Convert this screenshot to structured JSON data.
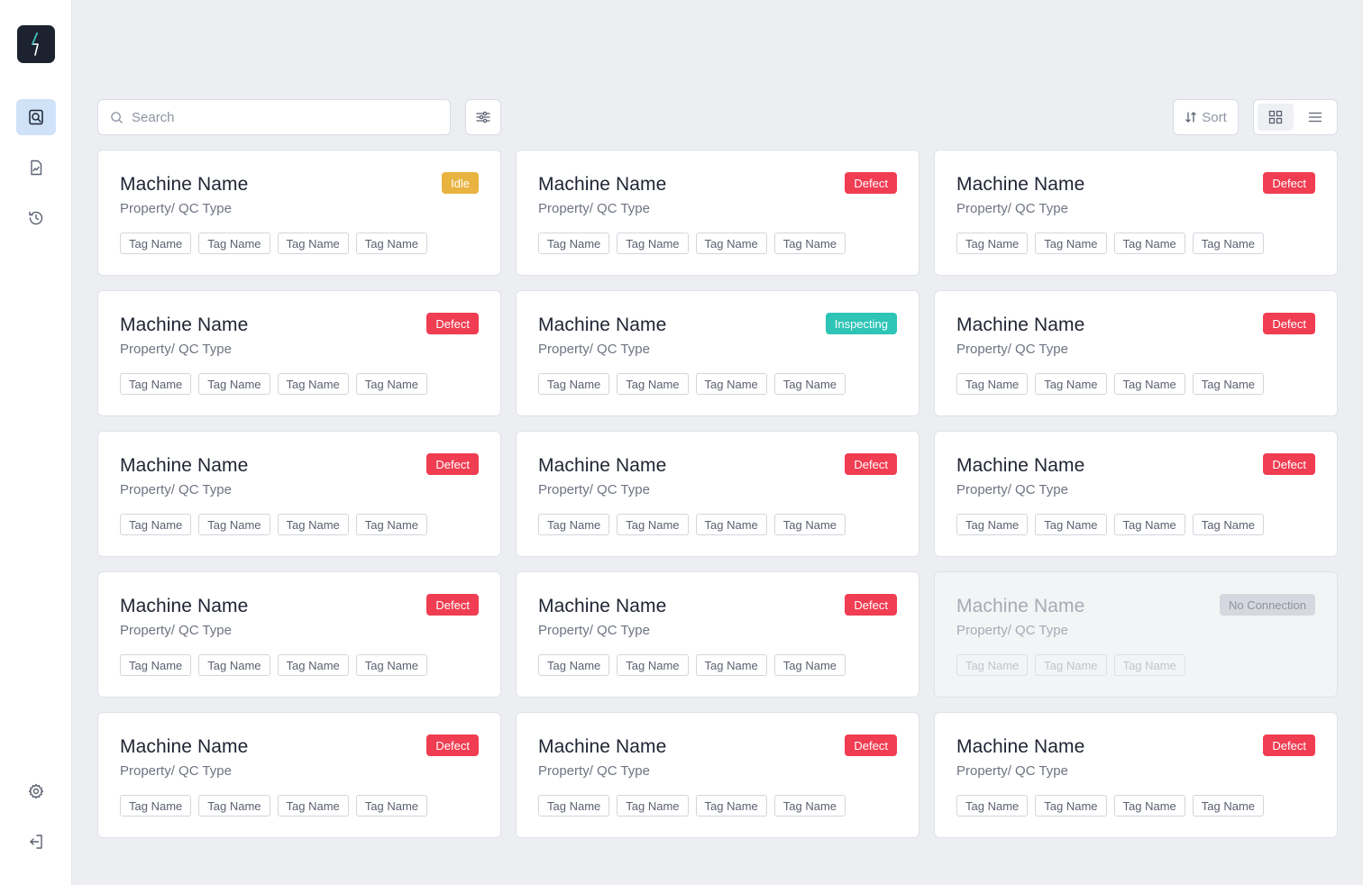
{
  "app": {
    "title": ""
  },
  "search": {
    "placeholder": "Search"
  },
  "toolbar": {
    "sort_label": "Sort"
  },
  "nav": {
    "items": [
      {
        "name": "inspect",
        "icon": "search-document-icon",
        "active": true
      },
      {
        "name": "reports",
        "icon": "chart-document-icon",
        "active": false
      },
      {
        "name": "history",
        "icon": "history-icon",
        "active": false
      }
    ],
    "bottom": [
      {
        "name": "settings",
        "icon": "gear-icon"
      },
      {
        "name": "logout",
        "icon": "logout-icon"
      }
    ]
  },
  "status_colors": {
    "Idle": "#e8b33f",
    "Defect": "#f03d52",
    "Inspecting": "#2ec4b6",
    "No Connection": "#d5d8de"
  },
  "cards": [
    {
      "title": "Machine Name",
      "subtitle": "Property/ QC Type",
      "status": "Idle",
      "tags": [
        "Tag Name",
        "Tag Name",
        "Tag Name",
        "Tag Name"
      ],
      "disabled": false
    },
    {
      "title": "Machine Name",
      "subtitle": "Property/ QC Type",
      "status": "Defect",
      "tags": [
        "Tag Name",
        "Tag Name",
        "Tag Name",
        "Tag Name"
      ],
      "disabled": false
    },
    {
      "title": "Machine Name",
      "subtitle": "Property/ QC Type",
      "status": "Defect",
      "tags": [
        "Tag Name",
        "Tag Name",
        "Tag Name",
        "Tag Name"
      ],
      "disabled": false
    },
    {
      "title": "Machine Name",
      "subtitle": "Property/ QC Type",
      "status": "Defect",
      "tags": [
        "Tag Name",
        "Tag Name",
        "Tag Name",
        "Tag Name"
      ],
      "disabled": false
    },
    {
      "title": "Machine Name",
      "subtitle": "Property/ QC Type",
      "status": "Inspecting",
      "tags": [
        "Tag Name",
        "Tag Name",
        "Tag Name",
        "Tag Name"
      ],
      "disabled": false
    },
    {
      "title": "Machine Name",
      "subtitle": "Property/ QC Type",
      "status": "Defect",
      "tags": [
        "Tag Name",
        "Tag Name",
        "Tag Name",
        "Tag Name"
      ],
      "disabled": false
    },
    {
      "title": "Machine Name",
      "subtitle": "Property/ QC Type",
      "status": "Defect",
      "tags": [
        "Tag Name",
        "Tag Name",
        "Tag Name",
        "Tag Name"
      ],
      "disabled": false
    },
    {
      "title": "Machine Name",
      "subtitle": "Property/ QC Type",
      "status": "Defect",
      "tags": [
        "Tag Name",
        "Tag Name",
        "Tag Name",
        "Tag Name"
      ],
      "disabled": false
    },
    {
      "title": "Machine Name",
      "subtitle": "Property/ QC Type",
      "status": "Defect",
      "tags": [
        "Tag Name",
        "Tag Name",
        "Tag Name",
        "Tag Name"
      ],
      "disabled": false
    },
    {
      "title": "Machine Name",
      "subtitle": "Property/ QC Type",
      "status": "Defect",
      "tags": [
        "Tag Name",
        "Tag Name",
        "Tag Name",
        "Tag Name"
      ],
      "disabled": false
    },
    {
      "title": "Machine Name",
      "subtitle": "Property/ QC Type",
      "status": "Defect",
      "tags": [
        "Tag Name",
        "Tag Name",
        "Tag Name",
        "Tag Name"
      ],
      "disabled": false
    },
    {
      "title": "Machine Name",
      "subtitle": "Property/ QC Type",
      "status": "No Connection",
      "tags": [
        "Tag Name",
        "Tag Name",
        "Tag Name"
      ],
      "disabled": true
    },
    {
      "title": "Machine Name",
      "subtitle": "Property/ QC Type",
      "status": "Defect",
      "tags": [
        "Tag Name",
        "Tag Name",
        "Tag Name",
        "Tag Name"
      ],
      "disabled": false
    },
    {
      "title": "Machine Name",
      "subtitle": "Property/ QC Type",
      "status": "Defect",
      "tags": [
        "Tag Name",
        "Tag Name",
        "Tag Name",
        "Tag Name"
      ],
      "disabled": false
    },
    {
      "title": "Machine Name",
      "subtitle": "Property/ QC Type",
      "status": "Defect",
      "tags": [
        "Tag Name",
        "Tag Name",
        "Tag Name",
        "Tag Name"
      ],
      "disabled": false
    }
  ]
}
